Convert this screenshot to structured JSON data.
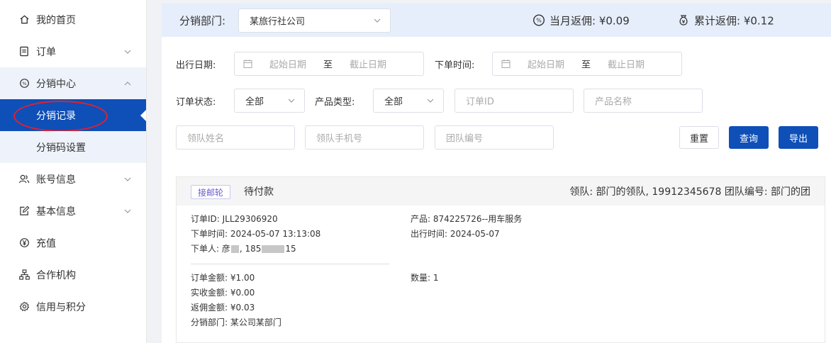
{
  "sidebar": {
    "items": [
      {
        "label": "我的首页",
        "icon": "home-icon"
      },
      {
        "label": "订单",
        "icon": "order-icon"
      },
      {
        "label": "分销中心",
        "icon": "distribution-icon"
      },
      {
        "label": "账号信息",
        "icon": "users-icon"
      },
      {
        "label": "基本信息",
        "icon": "edit-icon"
      },
      {
        "label": "充值",
        "icon": "yen-icon"
      },
      {
        "label": "合作机构",
        "icon": "org-icon"
      },
      {
        "label": "信用与积分",
        "icon": "gear-icon"
      }
    ],
    "sub_items": [
      {
        "label": "分销记录"
      },
      {
        "label": "分销码设置"
      }
    ]
  },
  "topbar": {
    "dept_label": "分销部门:",
    "dept_value": "某旅行社公司",
    "monthly_rebate": "当月返佣: ¥0.09",
    "total_rebate": "累计返佣: ¥0.12"
  },
  "filters": {
    "travel_date_label": "出行日期:",
    "order_time_label": "下单时间:",
    "start_placeholder": "起始日期",
    "end_placeholder": "截止日期",
    "range_sep": "至",
    "order_status_label": "订单状态:",
    "order_status_value": "全部",
    "product_type_label": "产品类型:",
    "product_type_value": "全部",
    "order_id_placeholder": "订单ID",
    "product_name_placeholder": "产品名称",
    "leader_name_placeholder": "领队姓名",
    "leader_phone_placeholder": "领队手机号",
    "team_no_placeholder": "团队编号",
    "reset_label": "重置",
    "search_label": "查询",
    "export_label": "导出"
  },
  "order": {
    "tag": "接邮轮",
    "status": "待付款",
    "leader_info": "领队: 部门的领队, 19912345678   团队编号: 部门的团",
    "order_id": "订单ID: JLL29306920",
    "order_time": "下单时间: 2024-05-07 13:13:08",
    "orderer_prefix": "下单人: 彦",
    "orderer_phone_prefix": ", 185",
    "orderer_phone_suffix": "15",
    "product": "产品: 874225726--用车服务",
    "travel_time": "出行时间: 2024-05-07",
    "order_amount": "订单金额: ¥1.00",
    "received_amount": "实收金额: ¥0.00",
    "rebate_amount": "返佣金额: ¥0.03",
    "dist_dept": "分销部门: 某公司某部门",
    "quantity": "数量: 1"
  },
  "colors": {
    "primary": "#0f4fb8",
    "highlight_oval": "#e5202a",
    "topbar_bg": "#e6eefb",
    "submenu_bg": "#eef3fb"
  }
}
